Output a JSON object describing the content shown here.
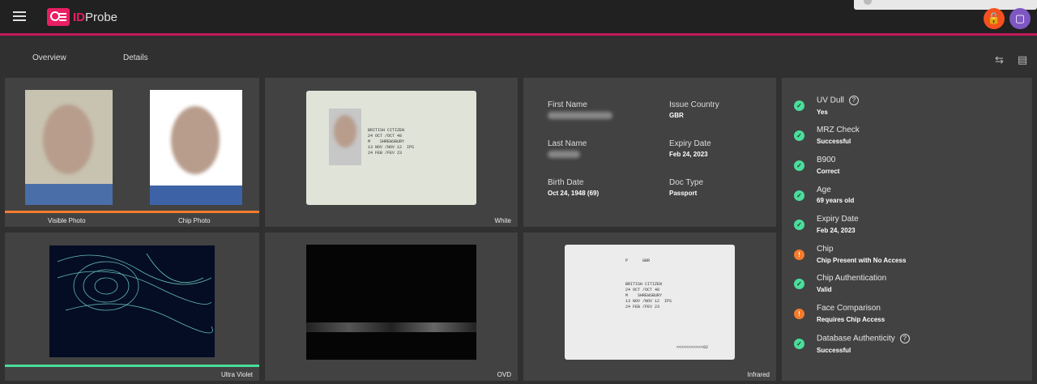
{
  "app": {
    "name_id": "ID",
    "name_rest": "Probe"
  },
  "tabs": [
    {
      "label": "Overview"
    },
    {
      "label": "Details"
    }
  ],
  "images": {
    "visible_photo": "Visible Photo",
    "chip_photo": "Chip Photo",
    "white": "White",
    "ultra_violet": "Ultra Violet",
    "ovd": "OVD",
    "infrared": "Infrared"
  },
  "doc_text": {
    "line1": "BRITISH CITIZEN",
    "line2": "24 OCT /OCT 48",
    "line3": "M    SHREWSBURY",
    "line4": "13 NOV /NOV 12  IPS",
    "line5": "24 FEB /FEV 23",
    "country_code": "GBR",
    "type_code": "P",
    "mrz_tail": "<<<<<<<<<<<02"
  },
  "fields": {
    "first_name_label": "First Name",
    "last_name_label": "Last Name",
    "birth_date_label": "Birth Date",
    "birth_date_value": "Oct 24, 1948 (69)",
    "issue_country_label": "Issue Country",
    "issue_country_value": "GBR",
    "expiry_date_label": "Expiry Date",
    "expiry_date_value": "Feb 24, 2023",
    "doc_type_label": "Doc Type",
    "doc_type_value": "Passport"
  },
  "checks": [
    {
      "title": "UV Dull",
      "value": "Yes",
      "status": "ok"
    },
    {
      "title": "MRZ Check",
      "value": "Successful",
      "status": "ok"
    },
    {
      "title": "B900",
      "value": "Correct",
      "status": "ok"
    },
    {
      "title": "Age",
      "value": "69 years old",
      "status": "ok"
    },
    {
      "title": "Expiry Date",
      "value": "Feb 24, 2023",
      "status": "ok"
    },
    {
      "title": "Chip",
      "value": "Chip Present with No Access",
      "status": "warn"
    },
    {
      "title": "Chip Authentication",
      "value": "Valid",
      "status": "ok"
    },
    {
      "title": "Face Comparison",
      "value": "Requires Chip Access",
      "status": "warn"
    },
    {
      "title": "Database Authenticity",
      "value": "Successful",
      "status": "ok"
    }
  ],
  "colors": {
    "accent": "#c2185b",
    "ok": "#4ade9c",
    "warn": "#f57c2c",
    "visible_bar": "#f57c2c",
    "uv_bar": "#4ade9c"
  },
  "icons": {
    "menu": "menu-icon",
    "lock": "lock-icon",
    "book": "library-icon",
    "help": "help-circle-icon",
    "check": "check-circle-icon",
    "warning": "warning-circle-icon"
  }
}
